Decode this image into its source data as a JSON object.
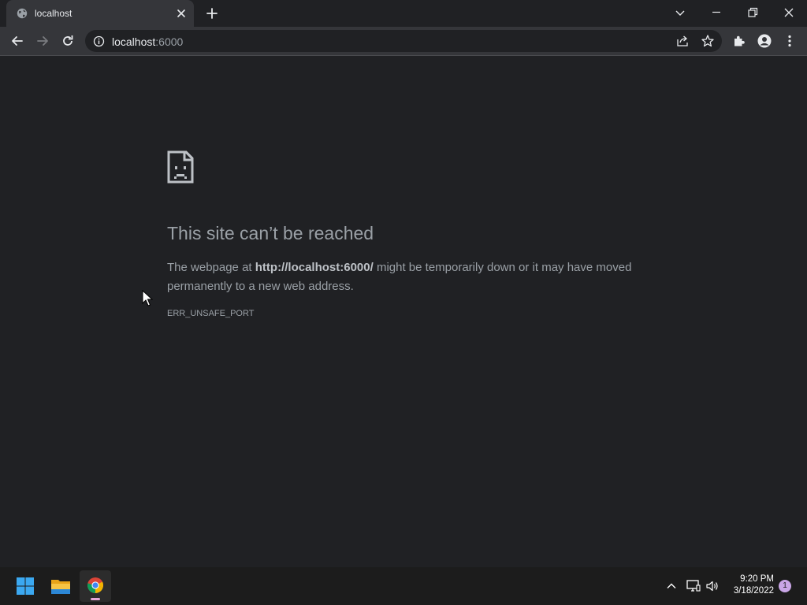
{
  "browser": {
    "tab": {
      "title": "localhost",
      "favicon": "globe-icon"
    },
    "new_tab_icon": "plus-icon",
    "window_controls": [
      "tab-search-icon",
      "minimize-icon",
      "restore-icon",
      "close-icon"
    ],
    "address": {
      "host": "localhost",
      "port": ":6000"
    },
    "toolbar_icons": [
      "back-icon",
      "forward-icon",
      "reload-icon",
      "info-icon",
      "share-icon",
      "star-icon",
      "extensions-icon",
      "profile-icon",
      "menu-icon"
    ]
  },
  "error_page": {
    "icon": "sad-page-icon",
    "title": "This site can’t be reached",
    "desc_prefix": "The webpage at ",
    "desc_url": "http://localhost:6000/",
    "desc_suffix": " might be temporarily down or it may have moved permanently to a new web address.",
    "code": "ERR_UNSAFE_PORT"
  },
  "taskbar": {
    "apps": [
      "windows-start-icon",
      "file-explorer-icon",
      "chrome-icon"
    ],
    "tray": [
      "chevron-up-icon",
      "network-icon",
      "volume-icon"
    ],
    "time": "9:20 PM",
    "date": "3/18/2022",
    "notification_count": "1"
  },
  "colors": {
    "background": "#202124",
    "toolbar": "#35363a",
    "text_muted": "#9aa0a6",
    "taskbar": "#1c1c1c"
  }
}
